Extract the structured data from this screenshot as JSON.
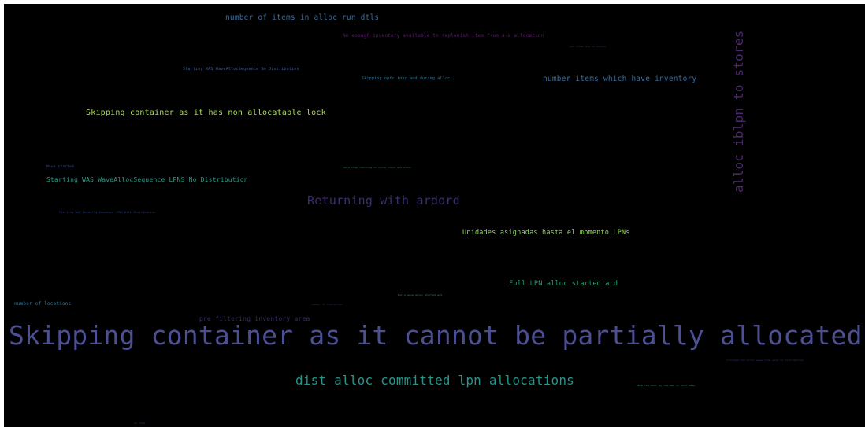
{
  "palette": {
    "background": "#000000",
    "frame": "#ffffff",
    "dark_purple": "#4a2a6a",
    "slate_blue": "#4c4f92",
    "steel_blue": "#3d6f9a",
    "teal": "#1f8e89",
    "sea_green": "#2aa87e",
    "lime": "#a9e04a",
    "yellow_green": "#7fd35a"
  },
  "words": [
    {
      "id": "w1",
      "text": "Skipping container as it cannot be partially allocated",
      "color": "#4c4f92"
    },
    {
      "id": "w2",
      "text": "dist alloc committed lpn allocations",
      "color": "#24968a"
    },
    {
      "id": "w3",
      "text": "alloc iblpn to stores",
      "color": "#4a2a6a"
    },
    {
      "id": "w4",
      "text": "Returning with ardord",
      "color": "#3f2c6e"
    },
    {
      "id": "w5",
      "text": "Skipping container as it has non allocatable lock",
      "color": "#a8e04b"
    },
    {
      "id": "w6",
      "text": "number of items in alloc run dtls",
      "color": "#3f6b9a"
    },
    {
      "id": "w7",
      "text": "number items which have inventory",
      "color": "#3b6d9b"
    },
    {
      "id": "w8",
      "text": "Unidades asignadas hasta el momento LPNs",
      "color": "#8edb55"
    },
    {
      "id": "w9",
      "text": "Full LPN alloc started ard",
      "color": "#2aa07f"
    },
    {
      "id": "w10",
      "text": "Starting WAS WaveAllocSequence LPNS No Distribution",
      "color": "#2a9a86"
    },
    {
      "id": "w11",
      "text": "pre filtering inventory area",
      "color": "#3d2c64"
    },
    {
      "id": "w12",
      "text": "No enough inventory available to replenish item from a-a allocation",
      "color": "#5a1f6a"
    },
    {
      "id": "w13",
      "text": "number of locations",
      "color": "#2f7a98"
    },
    {
      "id": "w14",
      "text": "Starting WAS WaveAllocSequence No Distribution",
      "color": "#3f5a92"
    },
    {
      "id": "w15",
      "text": "Skipping opfc inhr and during alloc",
      "color": "#2f7c9c"
    },
    {
      "id": "w16",
      "text": "Wave started",
      "color": "#3d4f8f"
    },
    {
      "id": "w17",
      "text": "Starting WAS WaveAllocSequence LPNS With Distribution",
      "color": "#2d3f7c"
    },
    {
      "id": "w18",
      "text": "skip item checking in cycle count and alloc",
      "color": "#2b8e7f"
    },
    {
      "id": "w19",
      "text": "number of iterations",
      "color": "#3e3570"
    },
    {
      "id": "w20",
      "text": "build wave alloc started ard",
      "color": "#2f9a7f"
    },
    {
      "id": "w21",
      "text": "finished the alloc wave from wave no distribution",
      "color": "#3d3a7d"
    },
    {
      "id": "w22",
      "text": "skip the unit by the way in unit base",
      "color": "#3aa07a"
    },
    {
      "id": "w23",
      "text": "lpn items are in stores",
      "color": "#3c3f7a"
    },
    {
      "id": "w24",
      "text": "no item",
      "color": "#3d3d6d"
    }
  ]
}
